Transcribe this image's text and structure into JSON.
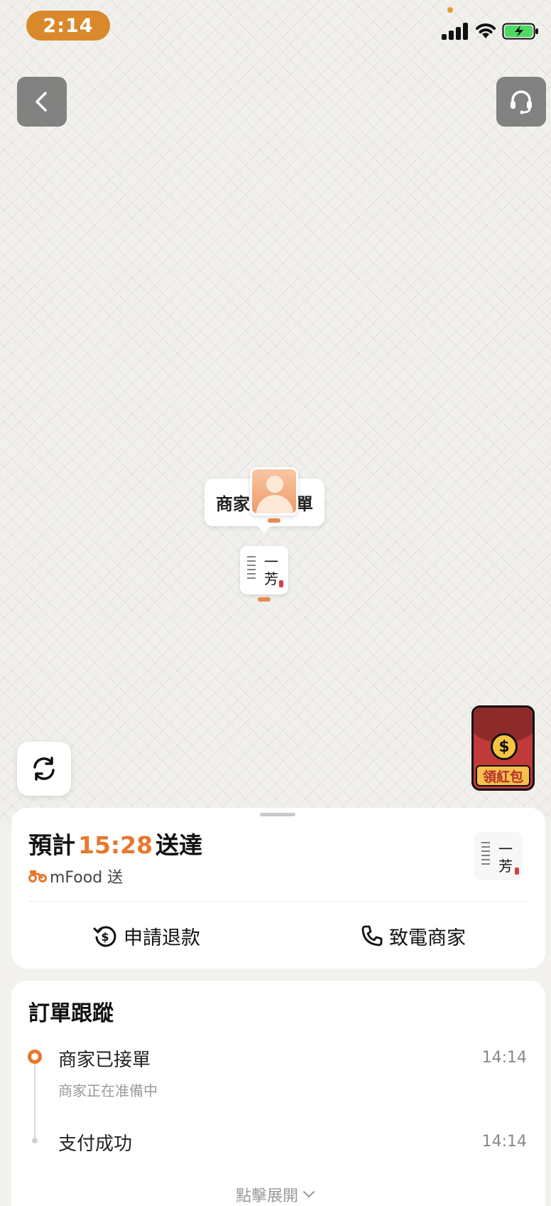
{
  "status_bar": {
    "time": "2:14"
  },
  "map": {
    "merchant_bubble_left": "商家",
    "merchant_bubble_right": "單",
    "shop_logo_glyph_top": "一",
    "shop_logo_glyph_bottom": "芳",
    "red_packet_label": "領紅包",
    "red_packet_symbol": "$"
  },
  "delivery": {
    "eta_prefix": "預計",
    "eta_time": "15:28",
    "eta_suffix": "送達",
    "courier": "mFood 送",
    "refund_label": "申請退款",
    "call_label": "致電商家"
  },
  "tracking": {
    "title": "訂單跟蹤",
    "steps": [
      {
        "title": "商家已接單",
        "subtitle": "商家正在准備中",
        "time": "14:14"
      },
      {
        "title": "支付成功",
        "time": "14:14"
      }
    ],
    "expand_label": "點擊展開"
  },
  "colors": {
    "accent": "#e8772e",
    "status_pill": "#d9892b"
  }
}
